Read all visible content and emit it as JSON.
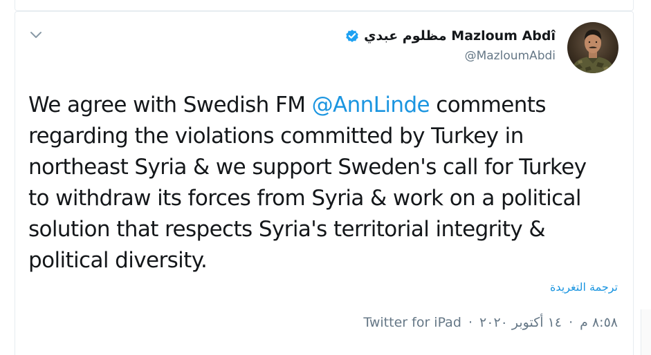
{
  "tweet": {
    "author": {
      "display_name": "مظلوم عبدي Mazloum Abdî",
      "handle": "@MazloumAbdi",
      "verified": true
    },
    "text": {
      "part1": "We agree with Swedish FM ",
      "mention": "@AnnLinde",
      "part2": " comments regarding the violations committed by Turkey in northeast Syria & we support Sweden's call for Turkey to withdraw its forces from Syria & work on a political solution that respects Syria's territorial integrity & political diversity."
    },
    "translate_label": "ترجمة التغريدة",
    "meta": {
      "time": "٨:٥٨ م",
      "separator": "·",
      "date": "١٤ أكتوبر ٢٠٢٠",
      "source": "Twitter for iPad"
    }
  },
  "colors": {
    "link": "#1b95e0",
    "text": "#14171a",
    "secondary": "#657786",
    "verified": "#1da1f2"
  },
  "icons": {
    "caret": "chevron-down-icon",
    "verified": "verified-badge-icon"
  }
}
